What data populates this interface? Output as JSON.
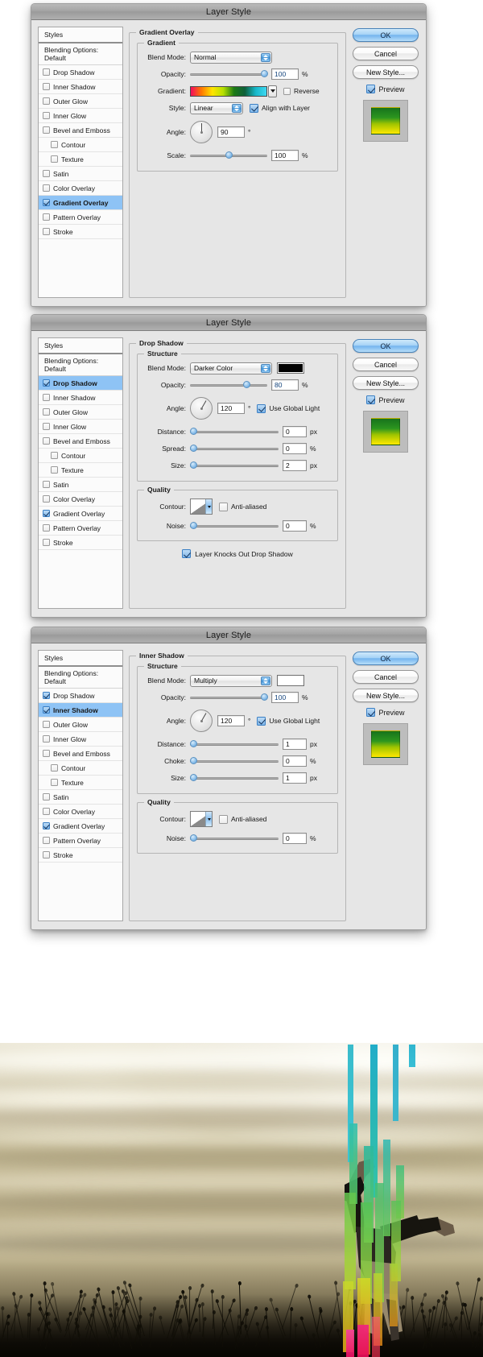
{
  "dialogs": [
    {
      "title": "Layer Style",
      "selected_effect": "Gradient Overlay",
      "styles_panel": {
        "header": "Styles",
        "blending_options": "Blending Options: Default",
        "items": [
          {
            "label": "Drop Shadow",
            "checked": false,
            "indent": false
          },
          {
            "label": "Inner Shadow",
            "checked": false,
            "indent": false
          },
          {
            "label": "Outer Glow",
            "checked": false,
            "indent": false
          },
          {
            "label": "Inner Glow",
            "checked": false,
            "indent": false
          },
          {
            "label": "Bevel and Emboss",
            "checked": false,
            "indent": false
          },
          {
            "label": "Contour",
            "checked": false,
            "indent": true
          },
          {
            "label": "Texture",
            "checked": false,
            "indent": true
          },
          {
            "label": "Satin",
            "checked": false,
            "indent": false
          },
          {
            "label": "Color Overlay",
            "checked": false,
            "indent": false
          },
          {
            "label": "Gradient Overlay",
            "checked": true,
            "indent": false
          },
          {
            "label": "Pattern Overlay",
            "checked": false,
            "indent": false
          },
          {
            "label": "Stroke",
            "checked": false,
            "indent": false
          }
        ]
      },
      "panel": {
        "legend": "Gradient Overlay",
        "section_legend": "Gradient",
        "blend_mode_label": "Blend Mode:",
        "blend_mode_value": "Normal",
        "opacity_label": "Opacity:",
        "opacity_value": "100",
        "opacity_unit": "%",
        "gradient_label": "Gradient:",
        "reverse_label": "Reverse",
        "reverse_checked": false,
        "style_label": "Style:",
        "style_value": "Linear",
        "align_label": "Align with Layer",
        "align_checked": true,
        "angle_label": "Angle:",
        "angle_value": "90",
        "angle_unit": "°",
        "scale_label": "Scale:",
        "scale_value": "100",
        "scale_unit": "%"
      },
      "buttons": {
        "ok": "OK",
        "cancel": "Cancel",
        "new_style": "New Style...",
        "preview_label": "Preview",
        "preview_checked": true
      }
    },
    {
      "title": "Layer Style",
      "selected_effect": "Drop Shadow",
      "styles_panel": {
        "header": "Styles",
        "blending_options": "Blending Options: Default",
        "items": [
          {
            "label": "Drop Shadow",
            "checked": true,
            "indent": false
          },
          {
            "label": "Inner Shadow",
            "checked": false,
            "indent": false
          },
          {
            "label": "Outer Glow",
            "checked": false,
            "indent": false
          },
          {
            "label": "Inner Glow",
            "checked": false,
            "indent": false
          },
          {
            "label": "Bevel and Emboss",
            "checked": false,
            "indent": false
          },
          {
            "label": "Contour",
            "checked": false,
            "indent": true
          },
          {
            "label": "Texture",
            "checked": false,
            "indent": true
          },
          {
            "label": "Satin",
            "checked": false,
            "indent": false
          },
          {
            "label": "Color Overlay",
            "checked": false,
            "indent": false
          },
          {
            "label": "Gradient Overlay",
            "checked": true,
            "indent": false
          },
          {
            "label": "Pattern Overlay",
            "checked": false,
            "indent": false
          },
          {
            "label": "Stroke",
            "checked": false,
            "indent": false
          }
        ]
      },
      "panel": {
        "legend": "Drop Shadow",
        "section_legend": "Structure",
        "blend_mode_label": "Blend Mode:",
        "blend_mode_value": "Darker Color",
        "blend_color": "#000000",
        "opacity_label": "Opacity:",
        "opacity_value": "80",
        "opacity_unit": "%",
        "angle_label": "Angle:",
        "angle_value": "120",
        "angle_unit": "°",
        "global_light_label": "Use Global Light",
        "global_light_checked": true,
        "distance_label": "Distance:",
        "distance_value": "0",
        "distance_unit": "px",
        "spread_label": "Spread:",
        "spread_value": "0",
        "spread_unit": "%",
        "size_label": "Size:",
        "size_value": "2",
        "size_unit": "px",
        "quality_legend": "Quality",
        "contour_label": "Contour:",
        "antialiased_label": "Anti-aliased",
        "antialiased_checked": false,
        "noise_label": "Noise:",
        "noise_value": "0",
        "noise_unit": "%",
        "knockout_label": "Layer Knocks Out Drop Shadow",
        "knockout_checked": true
      },
      "buttons": {
        "ok": "OK",
        "cancel": "Cancel",
        "new_style": "New Style...",
        "preview_label": "Preview",
        "preview_checked": true
      }
    },
    {
      "title": "Layer Style",
      "selected_effect": "Inner Shadow",
      "styles_panel": {
        "header": "Styles",
        "blending_options": "Blending Options: Default",
        "items": [
          {
            "label": "Drop Shadow",
            "checked": true,
            "indent": false
          },
          {
            "label": "Inner Shadow",
            "checked": true,
            "indent": false
          },
          {
            "label": "Outer Glow",
            "checked": false,
            "indent": false
          },
          {
            "label": "Inner Glow",
            "checked": false,
            "indent": false
          },
          {
            "label": "Bevel and Emboss",
            "checked": false,
            "indent": false
          },
          {
            "label": "Contour",
            "checked": false,
            "indent": true
          },
          {
            "label": "Texture",
            "checked": false,
            "indent": true
          },
          {
            "label": "Satin",
            "checked": false,
            "indent": false
          },
          {
            "label": "Color Overlay",
            "checked": false,
            "indent": false
          },
          {
            "label": "Gradient Overlay",
            "checked": true,
            "indent": false
          },
          {
            "label": "Pattern Overlay",
            "checked": false,
            "indent": false
          },
          {
            "label": "Stroke",
            "checked": false,
            "indent": false
          }
        ]
      },
      "panel": {
        "legend": "Inner Shadow",
        "section_legend": "Structure",
        "blend_mode_label": "Blend Mode:",
        "blend_mode_value": "Multiply",
        "blend_color": "#ffffff",
        "opacity_label": "Opacity:",
        "opacity_value": "100",
        "opacity_unit": "%",
        "angle_label": "Angle:",
        "angle_value": "120",
        "angle_unit": "°",
        "global_light_label": "Use Global Light",
        "global_light_checked": true,
        "distance_label": "Distance:",
        "distance_value": "1",
        "distance_unit": "px",
        "choke_label": "Choke:",
        "choke_value": "0",
        "choke_unit": "%",
        "size_label": "Size:",
        "size_value": "1",
        "size_unit": "px",
        "quality_legend": "Quality",
        "contour_label": "Contour:",
        "antialiased_label": "Anti-aliased",
        "antialiased_checked": false,
        "noise_label": "Noise:",
        "noise_value": "0",
        "noise_unit": "%"
      },
      "buttons": {
        "ok": "OK",
        "cancel": "Cancel",
        "new_style": "New Style...",
        "preview_label": "Preview",
        "preview_checked": true
      }
    }
  ],
  "colors": {
    "selection_blue": "#8ec3f5",
    "dialog_bg": "#e6e6e6",
    "gradient_stops": [
      "#f20b5e",
      "#ff7a00",
      "#ffe400",
      "#b6e000",
      "#1c7a15",
      "#0d5f3a",
      "#16b7c9",
      "#3ed8f2"
    ],
    "preview_swatch_gradient": [
      "#17731c",
      "#2f9a22",
      "#c8d400",
      "#ffe800"
    ]
  },
  "photo": {
    "description": "sepia-toned photograph of a person doing a handstand in a field under cloudy sky with colorful vertical ribbon stripes overlay"
  }
}
